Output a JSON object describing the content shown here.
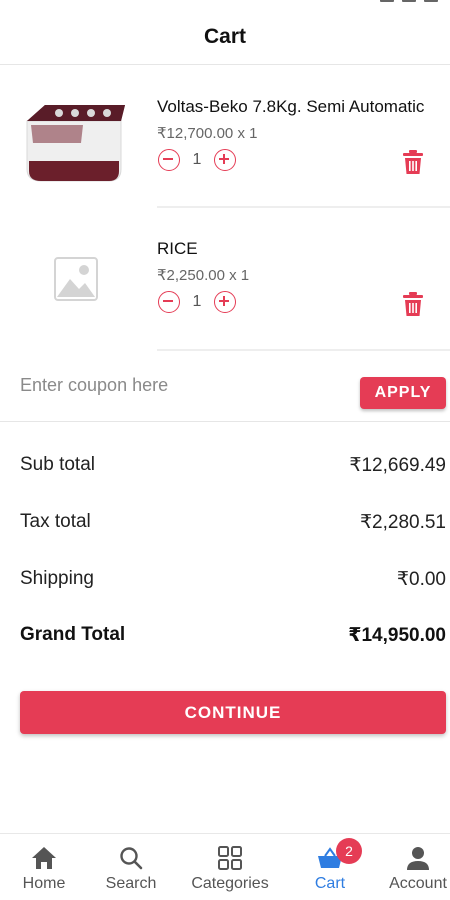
{
  "header": {
    "title": "Cart"
  },
  "items": [
    {
      "name": "Voltas-Beko 7.8Kg. Semi Automatic",
      "price": "₹12,700.00 x 1",
      "qty": "1",
      "image": "washing-machine"
    },
    {
      "name": "RICE",
      "price": "₹2,250.00 x 1",
      "qty": "1",
      "image": "placeholder-image"
    }
  ],
  "coupon": {
    "placeholder": "Enter coupon here",
    "value": "",
    "apply_label": "APPLY"
  },
  "totals": {
    "subtotal_label": "Sub total",
    "subtotal": "₹12,669.49",
    "tax_label": "Tax total",
    "tax": "₹2,280.51",
    "shipping_label": "Shipping",
    "shipping": "₹0.00",
    "grand_label": "Grand Total",
    "grand": "₹14,950.00"
  },
  "continue_label": "CONTINUE",
  "nav": [
    {
      "label": "Home",
      "icon": "home-icon"
    },
    {
      "label": "Search",
      "icon": "search-icon"
    },
    {
      "label": "Categories",
      "icon": "grid-icon"
    },
    {
      "label": "Cart",
      "icon": "basket-icon",
      "badge": "2",
      "active": true
    },
    {
      "label": "Account",
      "icon": "person-icon"
    }
  ],
  "colors": {
    "accent": "#e53c55",
    "active_nav": "#2f7de1"
  }
}
